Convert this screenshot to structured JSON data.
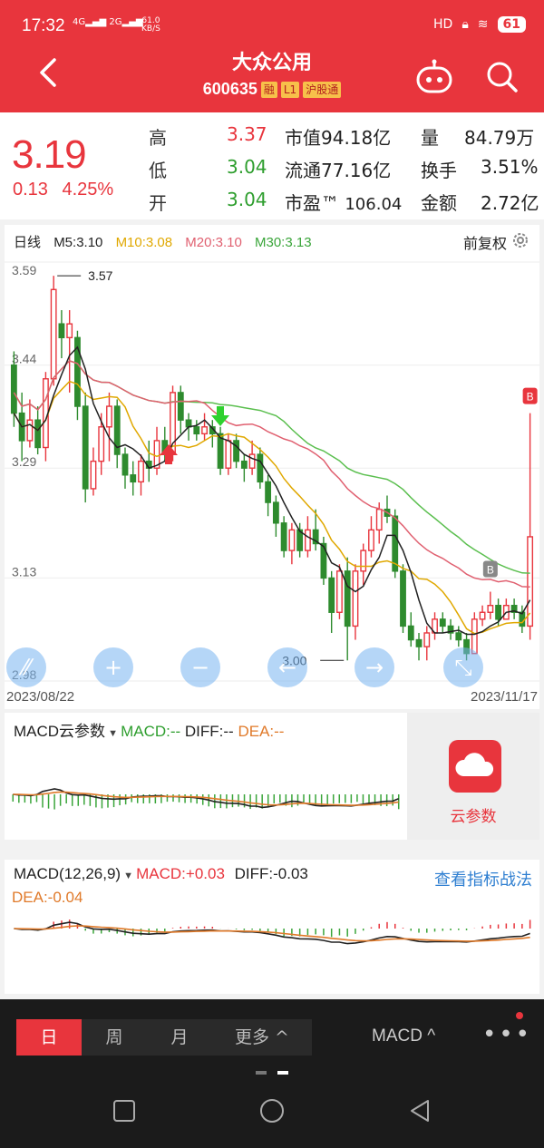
{
  "status": {
    "time": "17:32",
    "net1": "4G",
    "net2": "2G",
    "speed_val": "61.0",
    "speed_unit": "KB/S",
    "hd": "HD",
    "battery": "61"
  },
  "header": {
    "name": "大众公用",
    "code": "600635",
    "tags": [
      "融",
      "L1",
      "沪股通"
    ],
    "icons": [
      "back-icon",
      "robot-icon",
      "search-icon"
    ]
  },
  "quote": {
    "price": "3.19",
    "change": "0.13",
    "change_pct": "4.25%",
    "high_label": "高",
    "high": "3.37",
    "low_label": "低",
    "low": "3.04",
    "open_label": "开",
    "open": "3.04",
    "mktcap_label": "市值",
    "mktcap": "94.18亿",
    "float_label": "流通",
    "float": "77.16亿",
    "pe_label": "市盈™",
    "pe": "106.04",
    "vol_label": "量",
    "vol": "84.79万",
    "turnover_label": "换手",
    "turnover": "3.51%",
    "amount_label": "金额",
    "amount": "2.72亿"
  },
  "kline": {
    "period": "日线",
    "ma5": "M5:3.10",
    "ma10": "M10:3.08",
    "ma20": "M20:3.10",
    "ma30": "M30:3.13",
    "adjust": "前复权",
    "y_labels": [
      "3.59",
      "3.44",
      "3.29",
      "3.13",
      "2.98"
    ],
    "max_label": "3.57",
    "min_label": "3.00",
    "b_label": "B",
    "start_date": "2023/08/22",
    "end_date": "2023/11/17",
    "colors": {
      "up": "#e8353d",
      "down": "#2e8b2e",
      "ma5": "#222222",
      "ma10": "#e0a800",
      "ma20": "#e06070",
      "ma30": "#5bbf4f"
    },
    "candles": [
      [
        3.44,
        3.37,
        3.46,
        3.35
      ],
      [
        3.37,
        3.33,
        3.4,
        3.3
      ],
      [
        3.33,
        3.36,
        3.39,
        3.32
      ],
      [
        3.36,
        3.32,
        3.38,
        3.31
      ],
      [
        3.32,
        3.42,
        3.43,
        3.3
      ],
      [
        3.42,
        3.55,
        3.57,
        3.41
      ],
      [
        3.5,
        3.48,
        3.52,
        3.45
      ],
      [
        3.48,
        3.5,
        3.52,
        3.4
      ],
      [
        3.48,
        3.38,
        3.49,
        3.36
      ],
      [
        3.38,
        3.26,
        3.4,
        3.24
      ],
      [
        3.26,
        3.3,
        3.32,
        3.25
      ],
      [
        3.3,
        3.35,
        3.37,
        3.28
      ],
      [
        3.35,
        3.38,
        3.4,
        3.3
      ],
      [
        3.38,
        3.31,
        3.39,
        3.29
      ],
      [
        3.31,
        3.28,
        3.32,
        3.26
      ],
      [
        3.28,
        3.27,
        3.3,
        3.25
      ],
      [
        3.27,
        3.3,
        3.31,
        3.25
      ],
      [
        3.3,
        3.29,
        3.33,
        3.27
      ],
      [
        3.29,
        3.33,
        3.35,
        3.28
      ],
      [
        3.33,
        3.31,
        3.35,
        3.3
      ],
      [
        3.31,
        3.4,
        3.41,
        3.3
      ],
      [
        3.4,
        3.36,
        3.41,
        3.34
      ],
      [
        3.36,
        3.35,
        3.37,
        3.33
      ],
      [
        3.35,
        3.34,
        3.36,
        3.33
      ],
      [
        3.34,
        3.35,
        3.37,
        3.33
      ],
      [
        3.35,
        3.34,
        3.36,
        3.32
      ],
      [
        3.34,
        3.29,
        3.35,
        3.28
      ],
      [
        3.29,
        3.33,
        3.34,
        3.28
      ],
      [
        3.33,
        3.3,
        3.34,
        3.29
      ],
      [
        3.3,
        3.29,
        3.31,
        3.27
      ],
      [
        3.29,
        3.31,
        3.33,
        3.28
      ],
      [
        3.31,
        3.27,
        3.32,
        3.26
      ],
      [
        3.27,
        3.24,
        3.28,
        3.22
      ],
      [
        3.24,
        3.21,
        3.25,
        3.19
      ],
      [
        3.21,
        3.17,
        3.22,
        3.16
      ],
      [
        3.17,
        3.2,
        3.21,
        3.15
      ],
      [
        3.2,
        3.17,
        3.21,
        3.16
      ],
      [
        3.17,
        3.2,
        3.22,
        3.16
      ],
      [
        3.2,
        3.18,
        3.23,
        3.17
      ],
      [
        3.18,
        3.13,
        3.19,
        3.12
      ],
      [
        3.13,
        3.08,
        3.14,
        3.05
      ],
      [
        3.08,
        3.14,
        3.15,
        3.07
      ],
      [
        3.14,
        3.06,
        3.16,
        3.01
      ],
      [
        3.06,
        3.14,
        3.15,
        3.04
      ],
      [
        3.14,
        3.17,
        3.18,
        3.12
      ],
      [
        3.17,
        3.2,
        3.22,
        3.16
      ],
      [
        3.2,
        3.23,
        3.24,
        3.18
      ],
      [
        3.23,
        3.22,
        3.25,
        3.21
      ],
      [
        3.22,
        3.14,
        3.23,
        3.13
      ],
      [
        3.14,
        3.06,
        3.15,
        3.05
      ],
      [
        3.06,
        3.04,
        3.08,
        3.03
      ],
      [
        3.04,
        3.03,
        3.05,
        3.01
      ],
      [
        3.03,
        3.05,
        3.06,
        3.01
      ],
      [
        3.05,
        3.07,
        3.08,
        3.04
      ],
      [
        3.07,
        3.06,
        3.08,
        3.05
      ],
      [
        3.06,
        3.05,
        3.07,
        3.04
      ],
      [
        3.05,
        3.04,
        3.06,
        3.03
      ],
      [
        3.04,
        3.02,
        3.05,
        3.01
      ],
      [
        3.02,
        3.07,
        3.08,
        3.02
      ],
      [
        3.07,
        3.08,
        3.09,
        3.06
      ],
      [
        3.08,
        3.09,
        3.11,
        3.07
      ],
      [
        3.09,
        3.07,
        3.1,
        3.06
      ],
      [
        3.07,
        3.09,
        3.1,
        3.07
      ],
      [
        3.09,
        3.08,
        3.1,
        3.07
      ],
      [
        3.08,
        3.06,
        3.09,
        3.05
      ],
      [
        3.06,
        3.19,
        3.37,
        3.04
      ]
    ]
  },
  "macd_cloud": {
    "label": "MACD云参数",
    "macd": "MACD:--",
    "diff": "DIFF:--",
    "dea": "DEA:--",
    "cloud_label": "云参数"
  },
  "macd": {
    "label": "MACD(12,26,9)",
    "macd": "MACD:+0.03",
    "diff": "DIFF:-0.03",
    "dea": "DEA:-0.04",
    "link": "查看指标战法"
  },
  "bottom": {
    "tabs": [
      "日",
      "周",
      "月",
      "更多 ^"
    ],
    "indicator": "MACD ^",
    "more": "•••"
  }
}
